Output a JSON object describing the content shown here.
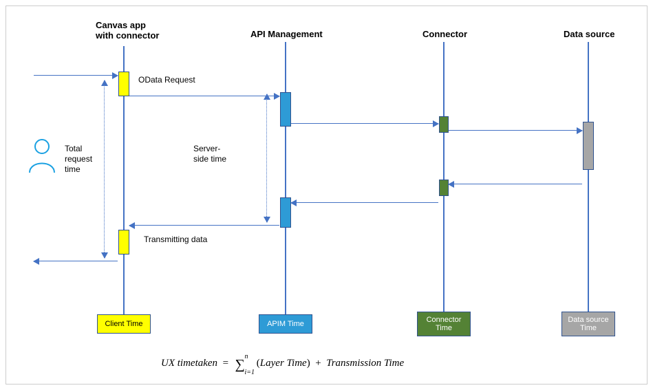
{
  "chart_data": {
    "type": "sequence-diagram",
    "lifelines": [
      {
        "id": "client",
        "label": "Canvas app\nwith connector",
        "footer": "Client Time",
        "color": "yellow"
      },
      {
        "id": "apim",
        "label": "API Management",
        "footer": "APIM Time",
        "color": "blue"
      },
      {
        "id": "connector",
        "label": "Connector",
        "footer": "Connector\nTime",
        "color": "green"
      },
      {
        "id": "datasource",
        "label": "Data source",
        "footer": "Data source\nTime",
        "color": "gray"
      }
    ],
    "messages": [
      {
        "from": "user",
        "to": "client",
        "label": "",
        "direction": "right"
      },
      {
        "from": "client",
        "to": "apim",
        "label": "OData Request",
        "direction": "right"
      },
      {
        "from": "apim",
        "to": "connector",
        "label": "",
        "direction": "right"
      },
      {
        "from": "connector",
        "to": "datasource",
        "label": "",
        "direction": "right"
      },
      {
        "from": "datasource",
        "to": "connector",
        "label": "",
        "direction": "left"
      },
      {
        "from": "connector",
        "to": "apim",
        "label": "",
        "direction": "left"
      },
      {
        "from": "apim",
        "to": "client",
        "label": "Transmitting data",
        "direction": "left"
      },
      {
        "from": "client",
        "to": "user",
        "label": "",
        "direction": "left"
      }
    ],
    "spans": [
      {
        "label": "Total\nrequest\ntime",
        "covers": "user-client full trip"
      },
      {
        "label": "Server-\nside time",
        "covers": "apim request to apim response"
      }
    ],
    "formula": "UX timetaken = Σ_{i=1}^{n} (Layer Time) + Transmission Time"
  },
  "headers": {
    "client_l1": "Canvas app",
    "client_l2": "with connector",
    "apim": "API Management",
    "connector": "Connector",
    "datasource": "Data source"
  },
  "labels": {
    "odata": "OData Request",
    "transmit": "Transmitting data",
    "total_l1": "Total",
    "total_l2": "request",
    "total_l3": "time",
    "server_l1": "Server-",
    "server_l2": "side time"
  },
  "footers": {
    "client": "Client Time",
    "apim": "APIM Time",
    "connector_l1": "Connector",
    "connector_l2": "Time",
    "datasource_l1": "Data source",
    "datasource_l2": "Time"
  },
  "formula": {
    "lhs_a": "UX",
    "lhs_b": "timetaken",
    "eq": "=",
    "sum_sup": "n",
    "sum_sub": "i=1",
    "term1a": "Layer",
    "term1b": "Time",
    "plus": "+",
    "term2a": "Transmission",
    "term2b": "Time"
  }
}
